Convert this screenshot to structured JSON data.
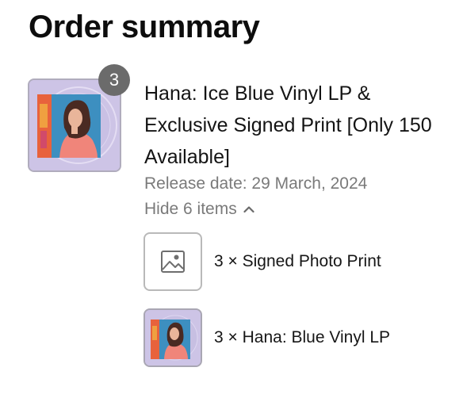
{
  "header": {
    "title": "Order summary"
  },
  "product": {
    "quantity": "3",
    "name": "Hana: Ice Blue Vinyl LP & Exclusive Signed Print [Only 150 Available]",
    "release_date": "Release date: 29 March, 2024",
    "toggle_label": "Hide 6 items",
    "thumbnail_icon": "album-cover-art",
    "colors": {
      "thumb_bg": "#cdc4e6",
      "badge_bg": "#6b6b6b",
      "muted_text": "#7a7a7a"
    }
  },
  "items": [
    {
      "label": "3 × Signed Photo Print",
      "thumbnail_icon": "image-placeholder-icon"
    },
    {
      "label": "3 × Hana: Blue Vinyl LP",
      "thumbnail_icon": "album-cover-art"
    }
  ]
}
